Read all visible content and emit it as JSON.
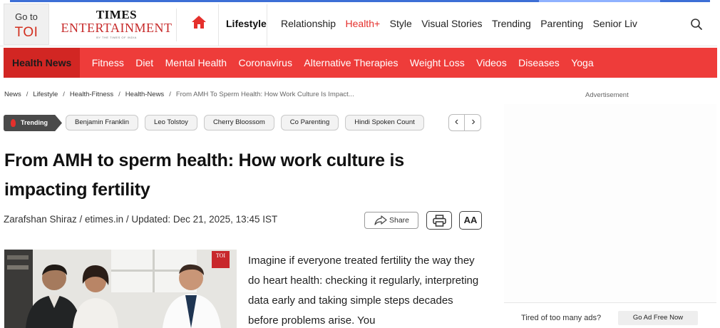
{
  "header": {
    "goto_line1": "Go to",
    "goto_line2": "TOI",
    "brand_line1": "TIMES",
    "brand_line2": "ENTERTAINMENT",
    "brand_tagline": "BY THE TIMES OF INDIA",
    "home_icon": "home-icon",
    "section": "Lifestyle",
    "nav": [
      {
        "label": "Relationship",
        "highlight": false
      },
      {
        "label": "Health+",
        "highlight": true
      },
      {
        "label": "Style",
        "highlight": false
      },
      {
        "label": "Visual Stories",
        "highlight": false
      },
      {
        "label": "Trending",
        "highlight": false
      },
      {
        "label": "Parenting",
        "highlight": false
      },
      {
        "label": "Senior Livi",
        "highlight": false
      }
    ],
    "search_icon": "search-icon"
  },
  "subnav": {
    "items": [
      "Health News",
      "Fitness",
      "Diet",
      "Mental Health",
      "Coronavirus",
      "Alternative Therapies",
      "Weight Loss",
      "Videos",
      "Diseases",
      "Yoga"
    ],
    "active_index": 0,
    "color": "#ee3c3a"
  },
  "breadcrumb": {
    "items": [
      "News",
      "Lifestyle",
      "Health-Fitness",
      "Health-News"
    ],
    "separator": "/",
    "current": "From AMH To Sperm Health: How Work Culture Is Impact..."
  },
  "trending": {
    "label": "Trending",
    "tags": [
      "Benjamin Franklin",
      "Leo Tolstoy",
      "Cherry Bloossom",
      "Co Parenting",
      "Hindi Spoken Count"
    ],
    "prev_label": "‹",
    "next_label": "›"
  },
  "article": {
    "headline": "From AMH to sperm health: How work culture is impacting fertility",
    "byline": "Zarafshan Shiraz / etimes.in / Updated: Dec 21, 2025, 13:45 IST",
    "share_label": "Share",
    "font_label": "AA",
    "image_logo": "TOI",
    "body": "Imagine if everyone treated fertility the way they do heart health: checking it regularly, interpreting data early and taking simple steps decades before problems arise. You"
  },
  "sidebar": {
    "ad_label": "Advertisement",
    "tired_text": "Tired of too many ads?",
    "ad_free_label": "Go Ad Free Now"
  },
  "colors": {
    "brand_red": "#ee3c3a",
    "active_tab": "#d22623",
    "highlight_text": "#e5302c"
  }
}
